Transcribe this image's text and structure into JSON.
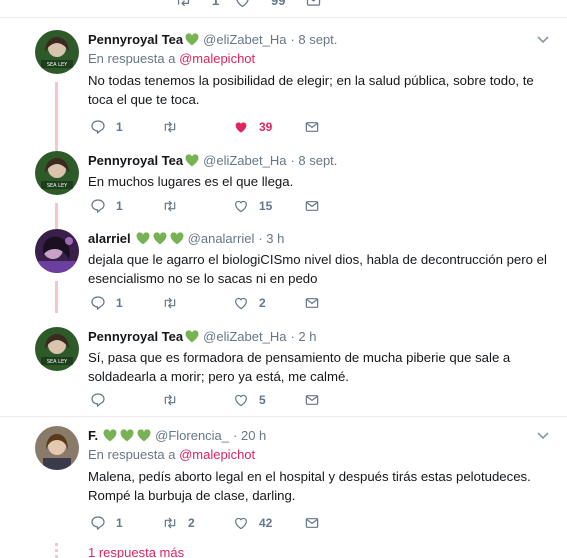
{
  "top_row": {
    "retweets": "1",
    "likes": "99"
  },
  "tweets": [
    {
      "name": "Pennyroyal Tea",
      "handle": "@eliZabet_Ha",
      "time": "· 8 sept.",
      "reply_prefix": "En respuesta a",
      "reply_to": "@malepichot",
      "text": "No todas tenemos la posibilidad de elegir; en la salud pública, sobre todo, te toca el que te toca.",
      "replies": "1",
      "retweets": "",
      "likes": "39",
      "liked": true
    },
    {
      "name": "Pennyroyal Tea",
      "handle": "@eliZabet_Ha",
      "time": "· 8 sept.",
      "text": "En muchos lugares es el que llega.",
      "replies": "1",
      "retweets": "",
      "likes": "15"
    },
    {
      "name": "alarriel",
      "handle": "@analarriel",
      "time": "· 3 h",
      "text": "dejala que le agarro el biologiCISmo nivel dios, habla de decontrucción pero el esencialismo no se lo sacas ni en pedo",
      "replies": "1",
      "retweets": "",
      "likes": "2"
    },
    {
      "name": "Pennyroyal Tea",
      "handle": "@eliZabet_Ha",
      "time": "· 2 h",
      "text": "Sí, pasa que es formadora de pensamiento de mucha piberie que sale a soldadearla a morir; pero ya está, me calmé.",
      "replies": "",
      "retweets": "",
      "likes": "5"
    },
    {
      "name": "F.",
      "handle": "@Florencia_",
      "time": "· 20 h",
      "reply_prefix": "En respuesta a",
      "reply_to": "@malepichot",
      "text": "Malena, pedís aborto legal en el hospital y después tirás estas pelotudeces. Rompé la burbuja de clase, darling.",
      "replies": "1",
      "retweets": "2",
      "likes": "42"
    }
  ],
  "more_replies": "1 respuesta más",
  "colors": {
    "accent": "#e0245e",
    "heart_green": "#77b255",
    "muted": "#657786",
    "thread": "#f5c6cb"
  },
  "icons": [
    "reply-icon",
    "retweet-icon",
    "like-icon",
    "dm-icon",
    "chevron-down-icon",
    "green-heart-icon"
  ]
}
